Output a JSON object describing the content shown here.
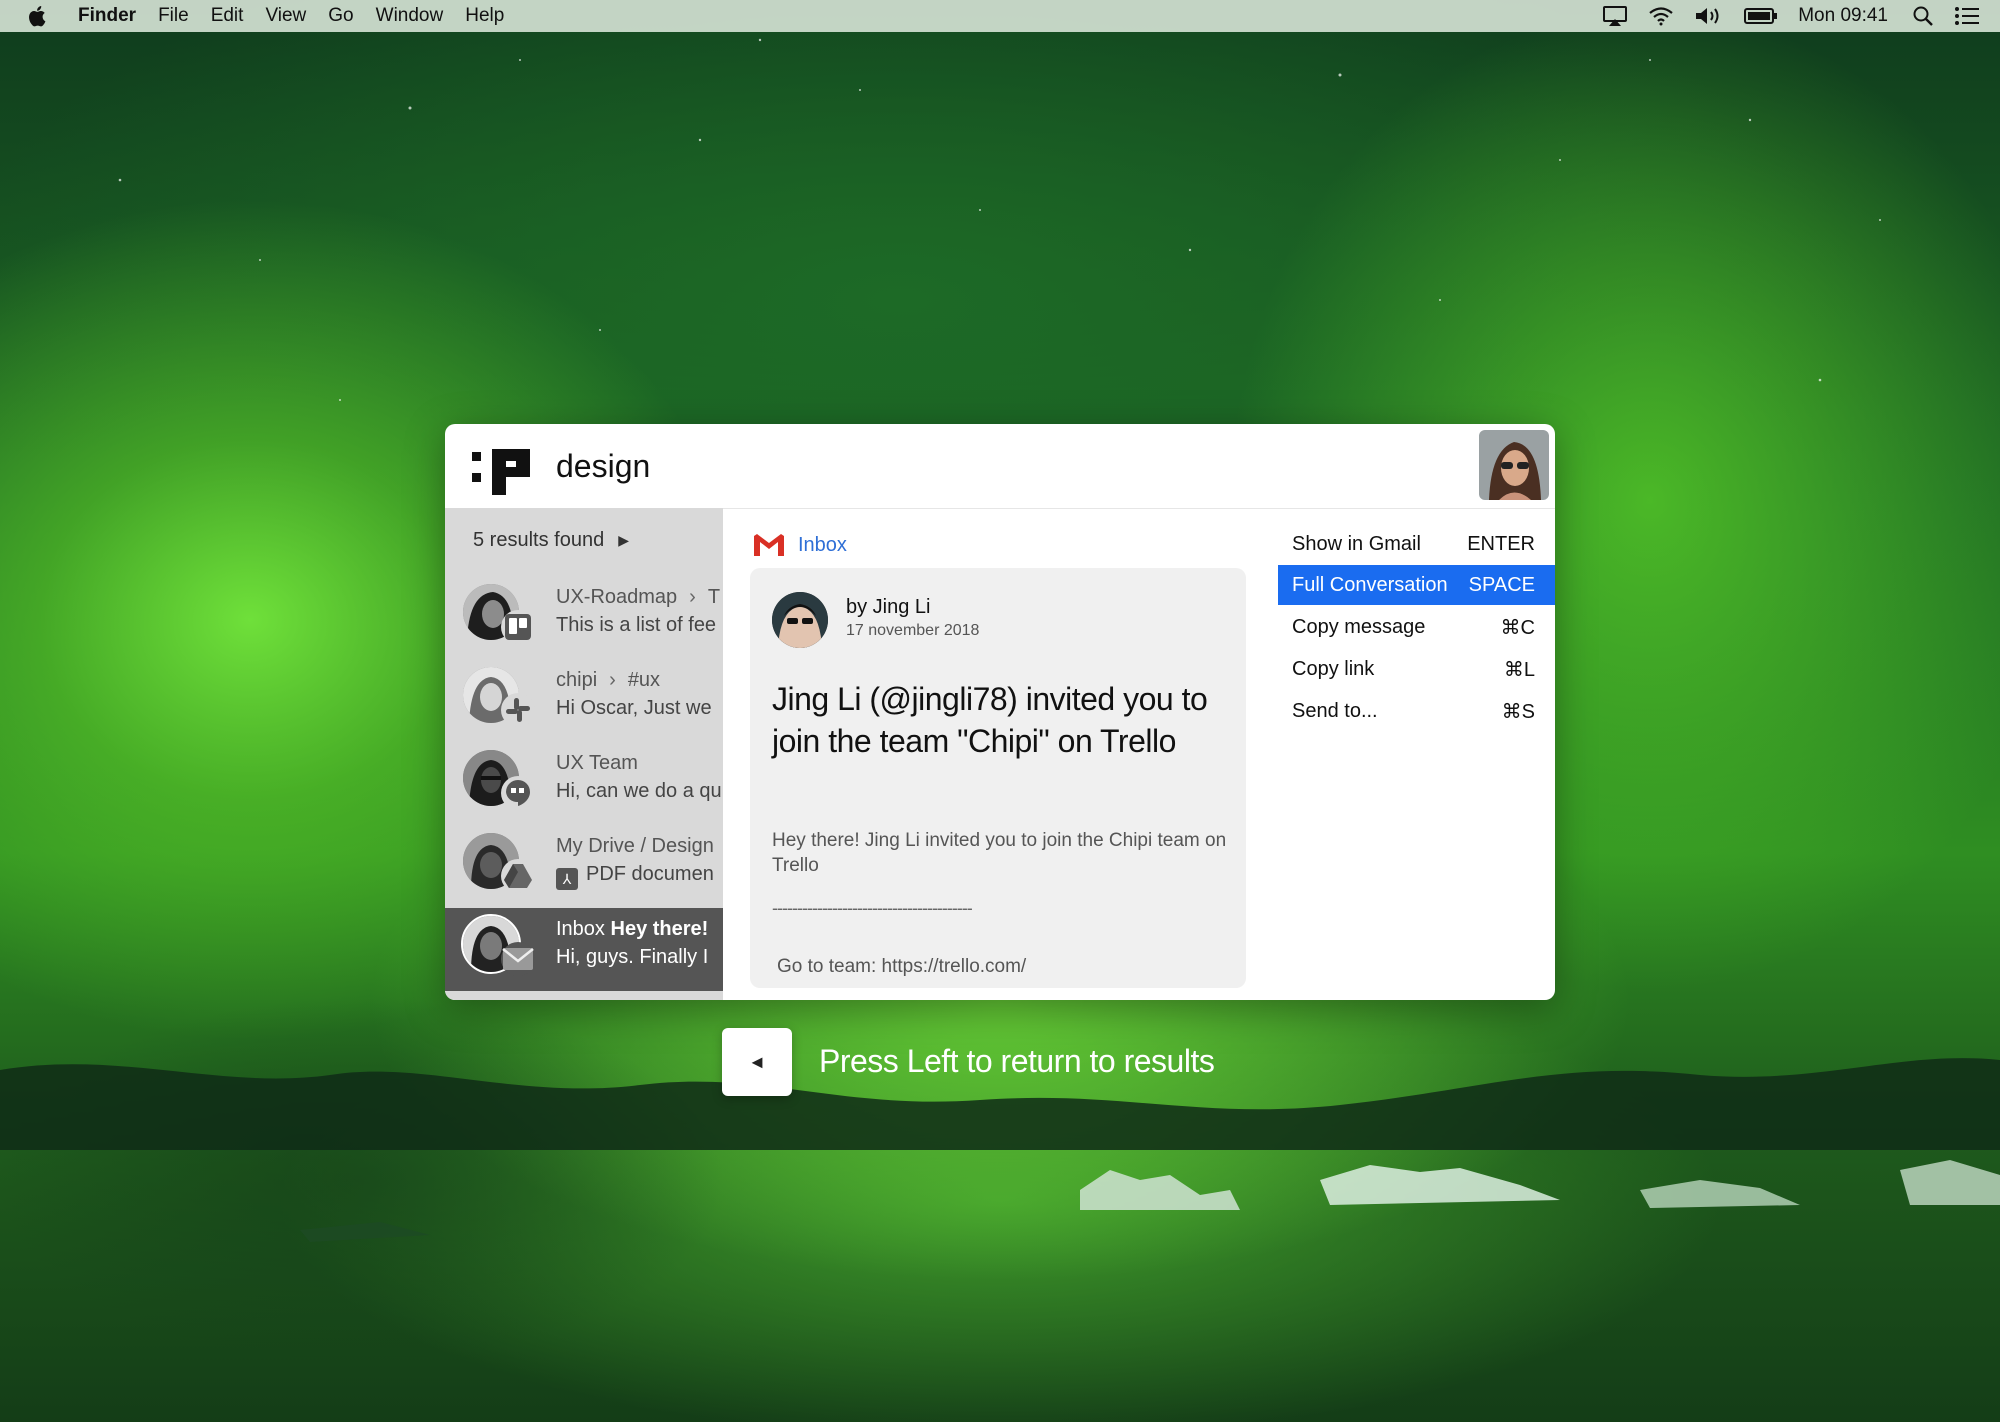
{
  "menubar": {
    "app_name": "Finder",
    "items": [
      "File",
      "Edit",
      "View",
      "Go",
      "Window",
      "Help"
    ],
    "clock": "Mon 09:41",
    "icons": [
      "airplay-icon",
      "wifi-icon",
      "volume-icon",
      "battery-icon",
      "spotlight-search-icon",
      "notification-center-icon"
    ]
  },
  "search": {
    "query": "design"
  },
  "results": {
    "count_label": "5 results found",
    "items": [
      {
        "title": "UX-Roadmap",
        "sub": "T",
        "snippet": "This is a list of fee",
        "badge": "trello-icon"
      },
      {
        "title": "chipi",
        "sub": "#ux",
        "snippet": "Hi Oscar, Just we",
        "badge": "slack-icon"
      },
      {
        "title": "UX Team",
        "sub": "",
        "snippet": "Hi, can we do a qu",
        "badge": "hangouts-icon"
      },
      {
        "title": "My Drive / Design",
        "sub": "",
        "snippet": "PDF documen",
        "badge": "google-drive-icon"
      },
      {
        "title": "Inbox",
        "sub": "Hey there!",
        "snippet": "Hi, guys. Finally I",
        "badge": "gmail-icon"
      }
    ]
  },
  "preview": {
    "source_label": "Inbox",
    "author": "by Jing Li",
    "date": "17 november 2018",
    "subject": "Jing Li (@jingli78) invited you to join the team \"Chipi\" on Trello",
    "body": "Hey there! Jing Li invited you to join the Chipi team on Trello",
    "divider": "----------------------------------------",
    "link_line": "Go to team: https://trello.com/"
  },
  "actions": [
    {
      "label": "Show in Gmail",
      "key": "ENTER"
    },
    {
      "label": "Full Conversation",
      "key": "SPACE"
    },
    {
      "label": "Copy message",
      "key": "⌘C"
    },
    {
      "label": "Copy link",
      "key": "⌘L"
    },
    {
      "label": "Send to...",
      "key": "⌘S"
    }
  ],
  "hint": {
    "key_glyph": "◄",
    "text": "Press Left to return to results"
  },
  "colors": {
    "accent": "#1a6cf0",
    "link": "#2f6fd6",
    "gmail_red": "#d93025"
  }
}
